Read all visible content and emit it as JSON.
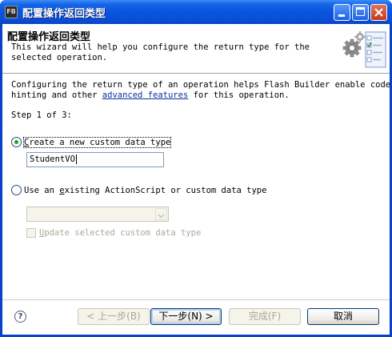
{
  "window": {
    "app_icon_text": "FB",
    "title": "配置操作返回类型"
  },
  "header": {
    "title": "配置操作返回类型",
    "description": "This wizard will help you configure the return type for the selected operation."
  },
  "intro": {
    "line1": "Configuring the return type of an operation helps Flash Builder enable code",
    "line2_prefix": "hinting and other ",
    "link_text": "advanced features",
    "line2_suffix": " for this operation."
  },
  "step_label": "Step 1 of 3:",
  "option_new": {
    "label_mnemonic": "C",
    "label_rest": "reate a new custom data type",
    "selected": true,
    "field_value": "StudentVO"
  },
  "option_existing": {
    "label_prefix": "Use an ",
    "label_mnemonic": "e",
    "label_rest": "xisting ActionScript or custom data type",
    "selected": false,
    "combo_value": ""
  },
  "update_checkbox": {
    "label_mnemonic": "U",
    "label_rest": "pdate selected custom data type",
    "checked": false,
    "enabled": false
  },
  "buttons": {
    "back": "< 上一步(B)",
    "next": "下一步(N) >",
    "finish": "完成(F)",
    "cancel": "取消"
  },
  "colors": {
    "titlebar": "#0a54df",
    "link": "#0a2f9e",
    "radio_dot": "#21a121",
    "disabled_text": "#aca899"
  },
  "icons": [
    "app-icon",
    "minimize-icon",
    "maximize-icon",
    "close-icon",
    "wizard-gears-icon",
    "help-icon",
    "chevron-down-icon"
  ]
}
